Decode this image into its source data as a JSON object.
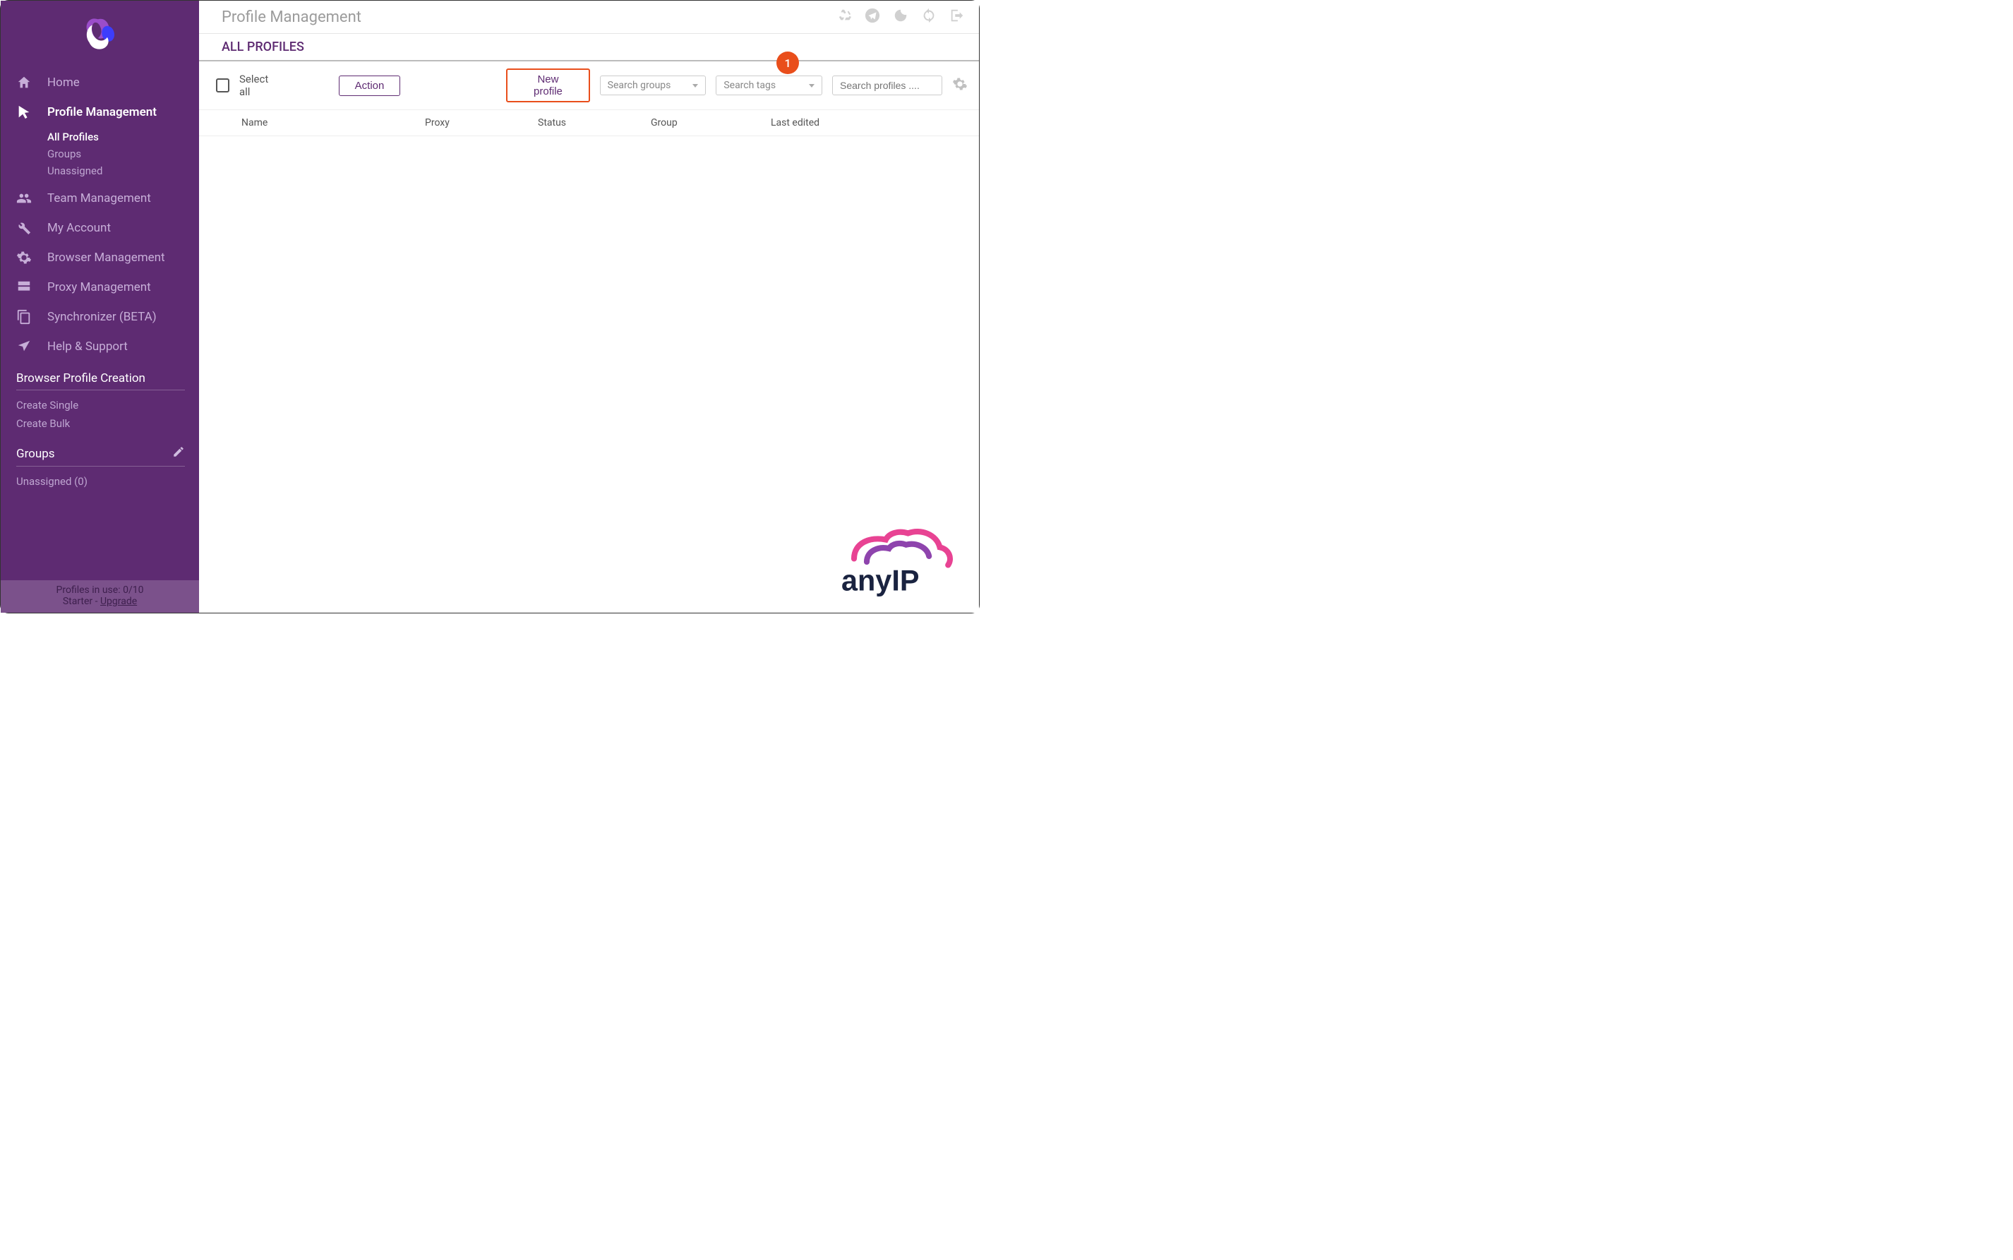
{
  "sidebar": {
    "nav": [
      {
        "label": "Home"
      },
      {
        "label": "Profile Management",
        "sub": [
          "All Profiles",
          "Groups",
          "Unassigned"
        ]
      },
      {
        "label": "Team Management"
      },
      {
        "label": "My Account"
      },
      {
        "label": "Browser Management"
      },
      {
        "label": "Proxy Management"
      },
      {
        "label": "Synchronizer (BETA)"
      },
      {
        "label": "Help & Support"
      }
    ],
    "profile_creation": {
      "title": "Browser Profile Creation",
      "items": [
        "Create Single",
        "Create Bulk"
      ]
    },
    "groups": {
      "title": "Groups",
      "items": [
        "Unassigned (0)"
      ]
    },
    "footer": {
      "line1_prefix": "Profiles in use:  ",
      "line1_value": "0/10",
      "line2_prefix": "Starter - ",
      "line2_link": "Upgrade"
    }
  },
  "header": {
    "title": "Profile Management",
    "subheader": "ALL PROFILES"
  },
  "toolbar": {
    "select_all": "Select all",
    "action_btn": "Action",
    "new_profile_btn": "New profile",
    "search_groups_placeholder": "Search groups",
    "search_tags_placeholder": "Search tags",
    "search_profiles_placeholder": "Search profiles ....",
    "badge": "1"
  },
  "table": {
    "columns": [
      "Name",
      "Proxy",
      "Status",
      "Group",
      "Last edited"
    ]
  },
  "watermark": "anyIP"
}
